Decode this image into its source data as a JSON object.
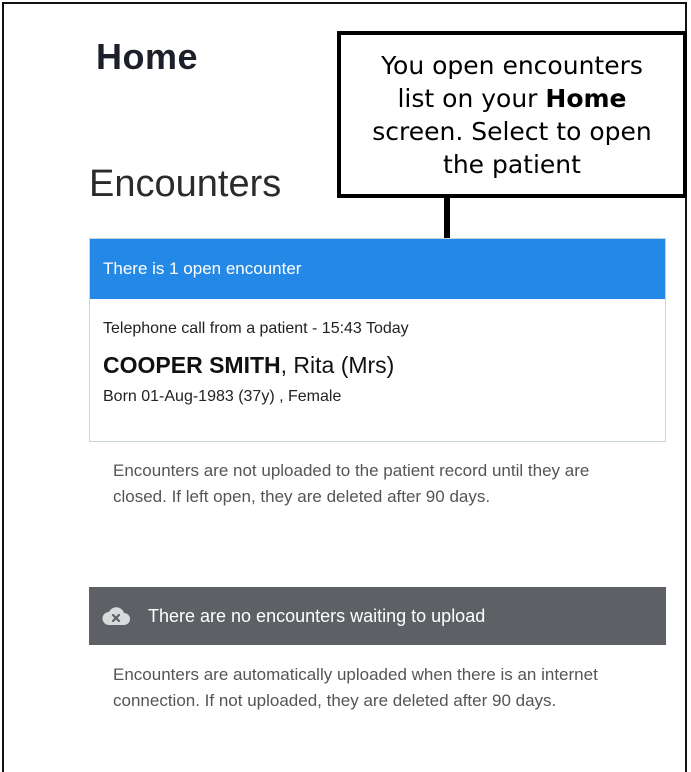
{
  "page": {
    "title": "Home",
    "section_title": "Encounters"
  },
  "callout": {
    "line1": "You open encounters",
    "line2_prefix": "list on your ",
    "line2_bold": "Home",
    "line3": "screen. Select to open",
    "line4": "the patient"
  },
  "open_encounters": {
    "header": "There is 1 open encounter",
    "encounter": {
      "description": "Telephone call from a patient  -  15:43  Today",
      "surname": "COOPER SMITH",
      "given_name": ", Rita (Mrs)",
      "born": "Born 01-Aug-1983 (37y) , Female"
    },
    "note": "Encounters are not uploaded to the patient record until they are closed. If left open, they are deleted after 90 days."
  },
  "upload": {
    "status": "There are no encounters waiting to upload",
    "icon": "cloud-x-icon",
    "note": "Encounters are automatically uploaded when there is an internet connection. If not uploaded, they are deleted after 90 days."
  },
  "colors": {
    "header_blue": "#2489e6",
    "upload_bar_gray": "#5d6064",
    "note_text": "#555555"
  }
}
